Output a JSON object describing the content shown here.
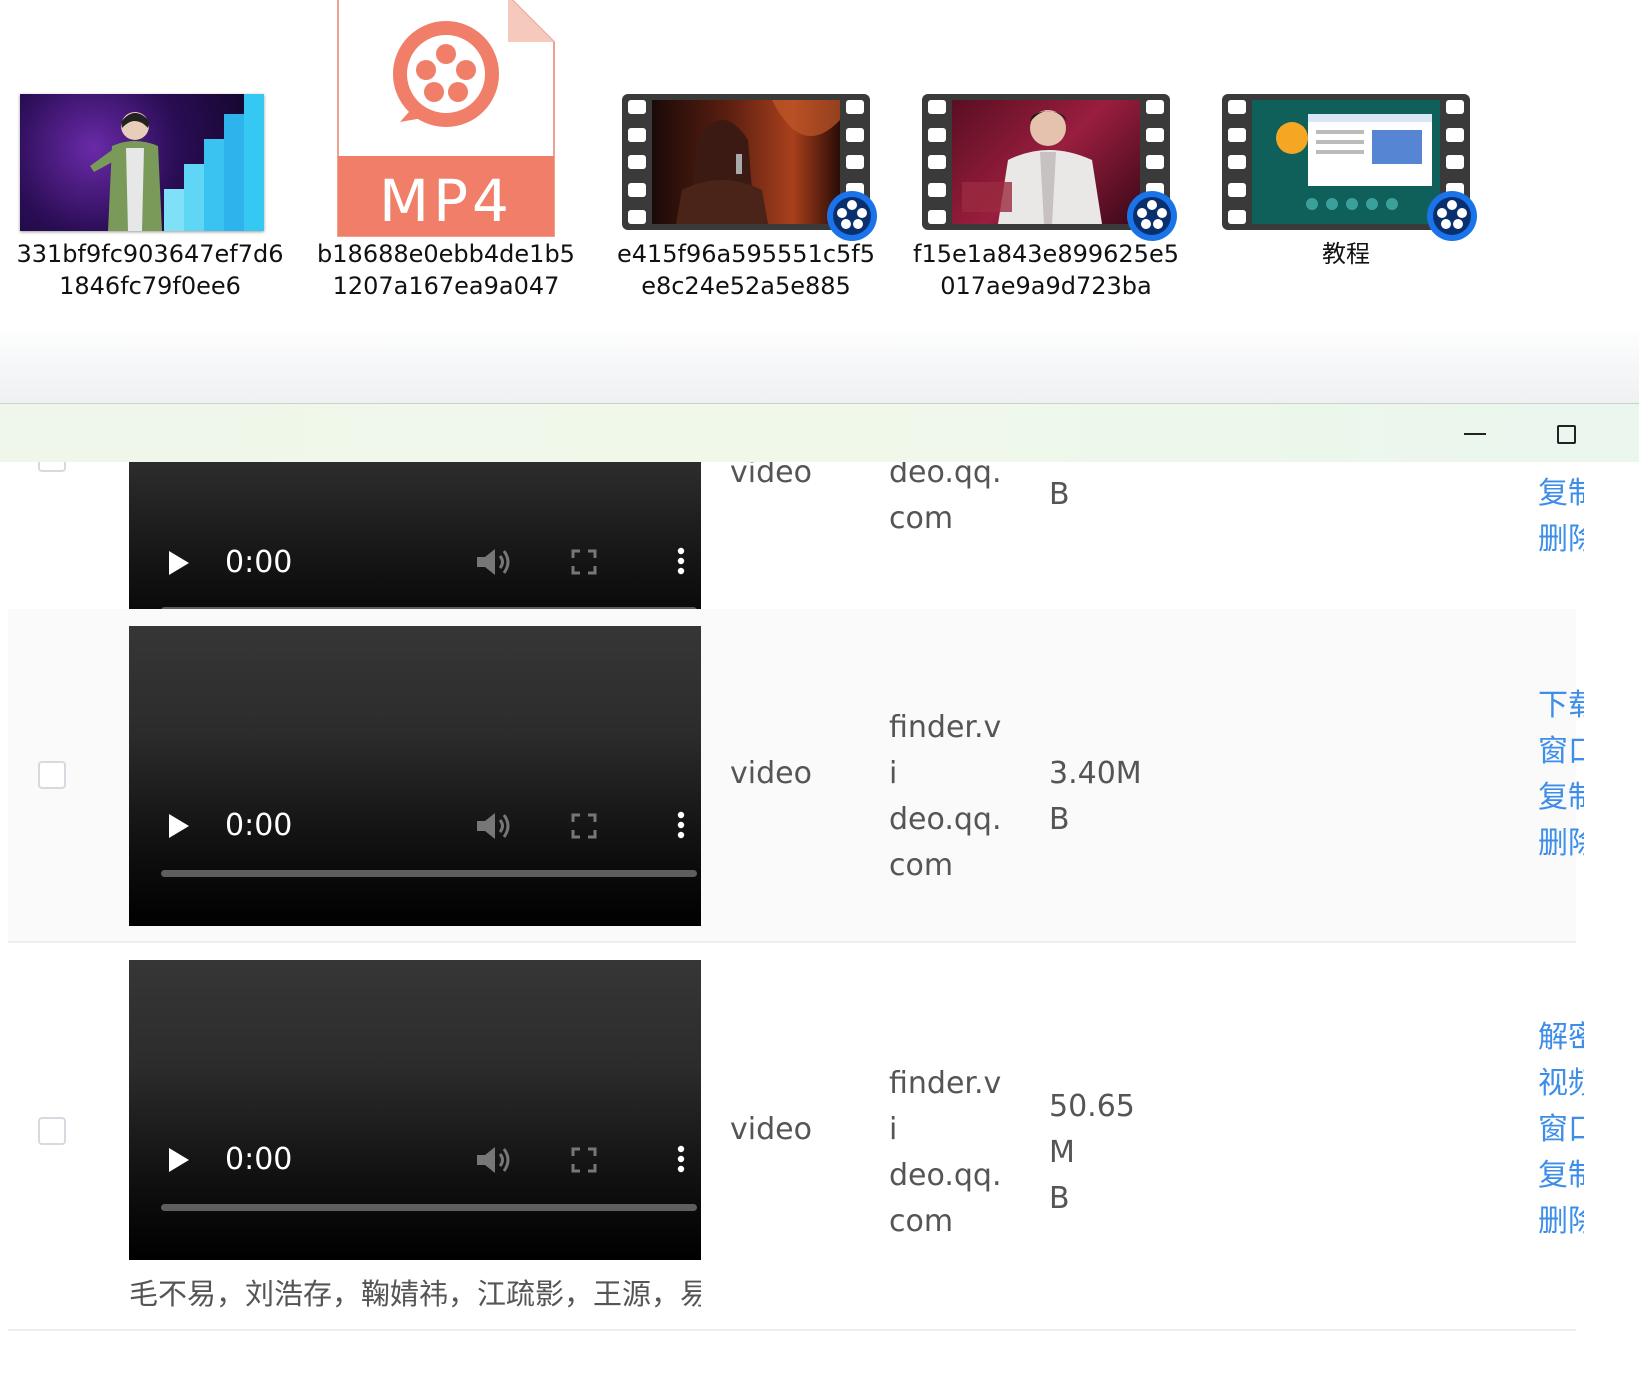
{
  "desktop": {
    "files": [
      {
        "name_line1": "331bf9fc903647ef7d6",
        "name_line2": "1846fc79f0ee6",
        "kind": "image-thumbnail"
      },
      {
        "name_line1": "b18688e0ebb4de1b5",
        "name_line2": "1207a167ea9a047",
        "kind": "mp4-document",
        "doc_label": "MP4"
      },
      {
        "name_line1": "e415f96a595551c5f5",
        "name_line2": "e8c24e52a5e885",
        "kind": "video-thumbnail"
      },
      {
        "name_line1": "f15e1a843e899625e5",
        "name_line2": "017ae9a9d723ba",
        "kind": "video-thumbnail"
      },
      {
        "name_line1": "教程",
        "name_line2": "",
        "kind": "video-thumbnail"
      }
    ]
  },
  "window": {
    "controls": {
      "minimize_icon": "minimize-icon",
      "maximize_icon": "maximize-icon"
    }
  },
  "rows": [
    {
      "player_time": "0:00",
      "type": "video",
      "host": "deo.qq.\ncom",
      "host_lines": [
        "deo.qq.",
        "com"
      ],
      "size_lines": [
        "B"
      ],
      "actions": [
        "复制",
        "删除"
      ],
      "checked": false
    },
    {
      "player_time": "0:00",
      "type": "video",
      "host_lines": [
        "finder.vi",
        "deo.qq.",
        "com"
      ],
      "size_lines": [
        "3.40MB"
      ],
      "actions": [
        "下载",
        "窗口",
        "复制",
        "删除"
      ],
      "checked": false
    },
    {
      "player_time": "0:00",
      "type": "video",
      "host_lines": [
        "finder.vi",
        "deo.qq.",
        "com"
      ],
      "size_lines": [
        "50.65M",
        "B"
      ],
      "actions": [
        "解密",
        "视频",
        "窗口",
        "复制",
        "删除"
      ],
      "description": "毛不易，刘浩存，鞠婧祎，江疏影，王源，易烊千玺",
      "checked": false
    }
  ],
  "colors": {
    "link": "#3d8ee8",
    "mp4_doc": "#f07e68",
    "player_badge": "#1a73e8",
    "titlebar": "#eef7e9"
  }
}
